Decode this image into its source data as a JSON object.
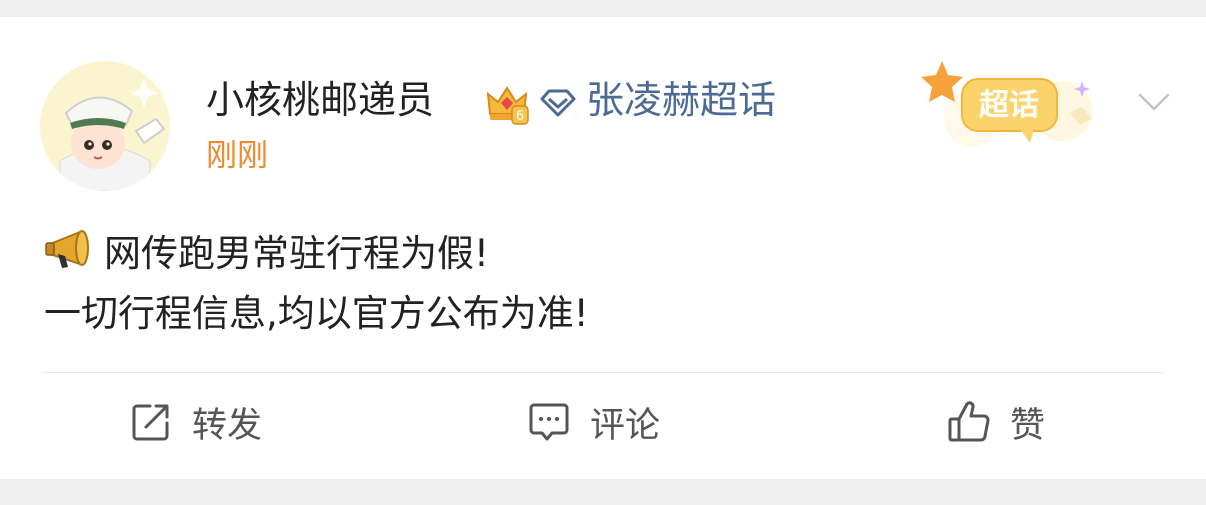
{
  "post": {
    "author": "小核桃邮递员",
    "topic": "张凌赫超话",
    "time": "刚刚",
    "badge_label": "超话",
    "crown_level": "6",
    "content": {
      "line1": "网传跑男常驻行程为假!",
      "line2": "一切行程信息,均以官方公布为准!"
    }
  },
  "actions": {
    "repost": "转发",
    "comment": "评论",
    "like": "赞"
  },
  "icons": {
    "avatar": "avatar",
    "crown": "crown-icon",
    "topic": "super-topic-icon",
    "badge": "super-topic-badge",
    "more": "chevron-down-icon",
    "megaphone": "megaphone-icon",
    "repost": "repost-icon",
    "comment": "comment-icon",
    "like": "thumbs-up-icon"
  },
  "colors": {
    "topic": "#4b6a94",
    "time": "#ee8a2e",
    "text": "#222222",
    "action": "#555555",
    "background": "#efefef"
  }
}
